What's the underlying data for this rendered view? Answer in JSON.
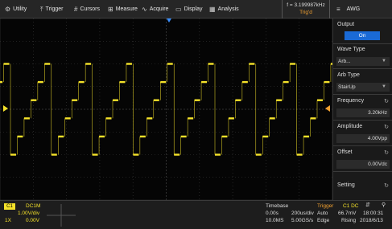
{
  "menu": {
    "items": [
      {
        "label": "Utility",
        "icon": "gear-icon",
        "glyph": "⚙"
      },
      {
        "label": "Trigger",
        "icon": "trigger-icon",
        "glyph": "⤒"
      },
      {
        "label": "Cursors",
        "icon": "cursors-icon",
        "glyph": "#"
      },
      {
        "label": "Measure",
        "icon": "measure-icon",
        "glyph": "⊞"
      },
      {
        "label": "Acquire",
        "icon": "acquire-icon",
        "glyph": "∿"
      },
      {
        "label": "Display",
        "icon": "display-icon",
        "glyph": "▭"
      },
      {
        "label": "Analysis",
        "icon": "analysis-icon",
        "glyph": "▦"
      }
    ],
    "freq": "f = 3.199987kHz",
    "trig_state": "Trig'd",
    "app": {
      "label": "AWG",
      "icon": "menu-icon",
      "glyph": "≡"
    }
  },
  "panel": {
    "output": {
      "title": "Output",
      "value": "On"
    },
    "wave_type": {
      "title": "Wave Type",
      "value": "Arb..."
    },
    "arb_type": {
      "title": "Arb Type",
      "value": "StairUp"
    },
    "frequency": {
      "title": "Frequency",
      "value": "3.20kHz"
    },
    "amplitude": {
      "title": "Amplitude",
      "value": "4.00Vpp"
    },
    "offset": {
      "title": "Offset",
      "value": "0.00Vdc"
    },
    "setting": {
      "title": "Setting"
    }
  },
  "status": {
    "channel": "C1",
    "coupling": "DC1M",
    "vdiv": "1.00V/div",
    "probe": "1X",
    "offset": "0.00V",
    "timebase_title": "Timebase",
    "delay": "0.00s",
    "tdiv": "200us/div",
    "mem": "10.0MS",
    "srate": "5.00GS/s",
    "trigger_title": "Trigger",
    "trig_src": "C1 DC",
    "trig_mode": "Auto",
    "trig_level": "66.7mV",
    "trig_type": "Edge",
    "trig_slope": "Rising",
    "time": "18:00:31",
    "date": "2018/6/13"
  },
  "colors": {
    "trace": "#f5e22a",
    "accent_blue": "#1a6ad6",
    "trigger_orange": "#f0a030",
    "grid": "#3a3a3a"
  },
  "waveform": {
    "frequency_hz": 3200,
    "steps_per_period": 6,
    "amplitude_vpp": 4.0,
    "offset_v": 0.0
  }
}
